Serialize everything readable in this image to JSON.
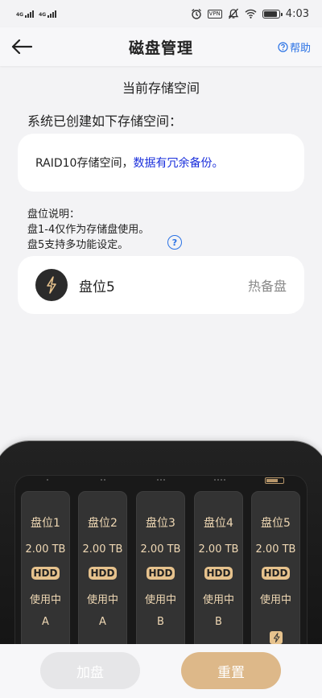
{
  "status_bar": {
    "network_1": "4G",
    "network_2": "4G",
    "vpn": "VPN",
    "time": "4:03",
    "battery_level": 0.9
  },
  "header": {
    "title": "磁盘管理",
    "help": "帮助"
  },
  "storage": {
    "subtitle": "当前存储空间",
    "intro": "系统已创建如下存储空间：",
    "raid_prefix": "RAID10存储空间，",
    "raid_note": "数据有冗余备份。"
  },
  "notes": {
    "title": "盘位说明：",
    "line1": "盘1-4仅作为存储盘使用。",
    "line2": "盘5支持多功能设定。",
    "help_mark": "?"
  },
  "slot5": {
    "name": "盘位5",
    "mode": "热备盘"
  },
  "bays": [
    {
      "name": "盘位1",
      "capacity": "2.00 TB",
      "type": "HDD",
      "status": "使用中",
      "group": "A"
    },
    {
      "name": "盘位2",
      "capacity": "2.00 TB",
      "type": "HDD",
      "status": "使用中",
      "group": "A"
    },
    {
      "name": "盘位3",
      "capacity": "2.00 TB",
      "type": "HDD",
      "status": "使用中",
      "group": "B"
    },
    {
      "name": "盘位4",
      "capacity": "2.00 TB",
      "type": "HDD",
      "status": "使用中",
      "group": "B"
    },
    {
      "name": "盘位5",
      "capacity": "2.00 TB",
      "type": "HDD",
      "status": "使用中",
      "group": ""
    }
  ],
  "buttons": {
    "add": "加盘",
    "reset": "重置"
  },
  "colors": {
    "accent_blue": "#2a72e5",
    "raid_blue": "#1a2fdc",
    "gold": "#ddb889",
    "bay_text": "#efd8b4"
  }
}
